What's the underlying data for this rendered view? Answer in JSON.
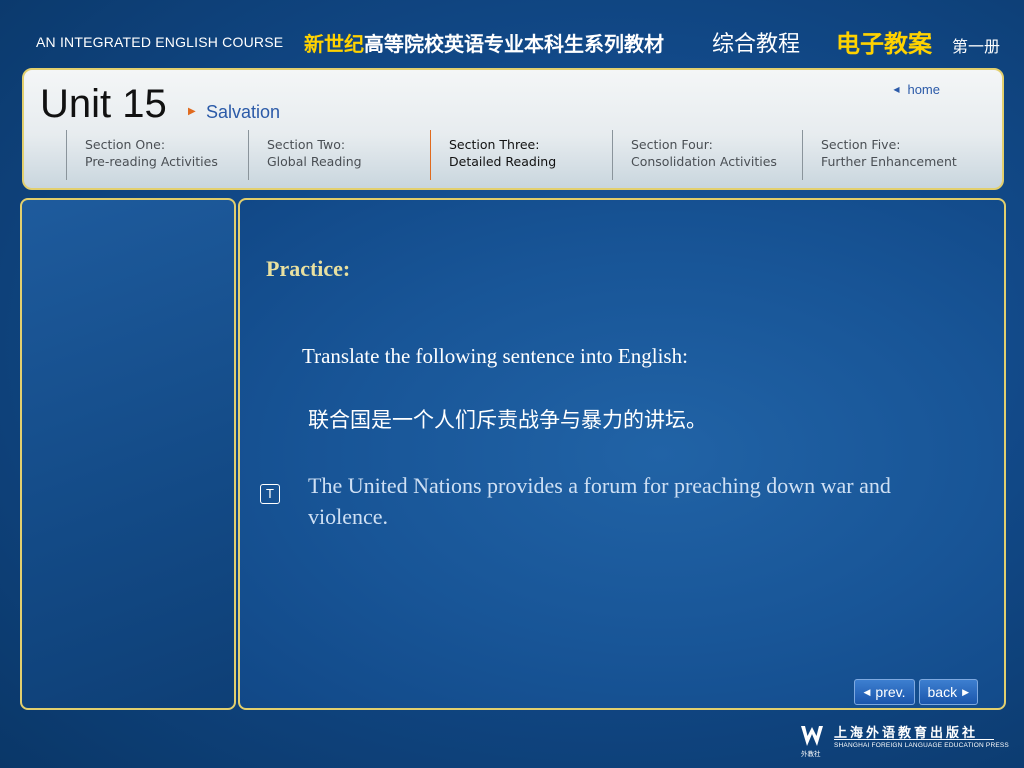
{
  "header": {
    "course_title": "AN INTEGRATED ENGLISH COURSE",
    "series_accent": "新世纪",
    "series_rest": "高等院校英语专业本科生系列教材",
    "course_name": "综合教程",
    "lesson_plan": "电子教案",
    "volume": "第一册"
  },
  "unit": {
    "title": "Unit 15",
    "subtitle": "Salvation",
    "home_label": "home"
  },
  "sections": [
    {
      "title": "Section One:",
      "sub": "Pre-reading Activities"
    },
    {
      "title": "Section Two:",
      "sub": "Global Reading"
    },
    {
      "title": "Section Three:",
      "sub": "Detailed Reading"
    },
    {
      "title": "Section Four:",
      "sub": "Consolidation Activities"
    },
    {
      "title": "Section Five:",
      "sub": "Further Enhancement"
    }
  ],
  "active_section_index": 2,
  "content": {
    "heading": "Practice:",
    "instruction": "Translate the following sentence into English:",
    "sentence_cn": "联合国是一个人们斥责战争与暴力的讲坛。",
    "translate_icon_label": "T",
    "answer": "The United Nations provides a forum for preaching down war and violence."
  },
  "nav": {
    "prev_label": "prev.",
    "back_label": "back"
  },
  "publisher": {
    "name_cn": "上海外语教育出版社",
    "name_en": "SHANGHAI FOREIGN LANGUAGE EDUCATION PRESS",
    "logo_text": "外教社"
  },
  "colors": {
    "accent_yellow": "#ffd200",
    "panel_border": "#e2cf6e",
    "active_section_border": "#e06a1e",
    "link_blue": "#2b5aa8",
    "background": "#0d3f78"
  }
}
